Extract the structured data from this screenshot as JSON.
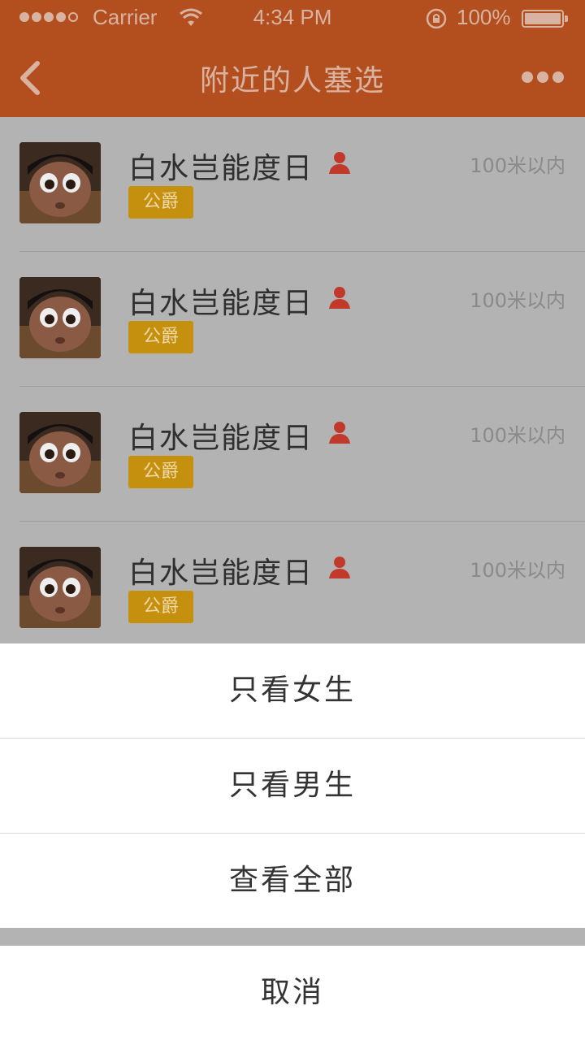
{
  "status_bar": {
    "carrier": "Carrier",
    "time": "4:34 PM",
    "battery_percent": "100%",
    "signal_bars_filled": 4,
    "signal_bars_total": 5
  },
  "nav": {
    "title": "附近的人塞选",
    "back_icon": "chevron-left-icon",
    "more_icon": "more-dots-icon"
  },
  "people": [
    {
      "name": "白水岂能度日",
      "badge": "公爵",
      "distance": "100米以内",
      "gender_icon": "female-icon"
    },
    {
      "name": "白水岂能度日",
      "badge": "公爵",
      "distance": "100米以内",
      "gender_icon": "female-icon"
    },
    {
      "name": "白水岂能度日",
      "badge": "公爵",
      "distance": "100米以内",
      "gender_icon": "female-icon"
    },
    {
      "name": "白水岂能度日",
      "badge": "公爵",
      "distance": "100米以内",
      "gender_icon": "female-icon"
    }
  ],
  "action_sheet": {
    "options": [
      "只看女生",
      "只看男生",
      "查看全部"
    ],
    "cancel": "取消"
  },
  "colors": {
    "header": "#b34f1f",
    "overlay": "#b3b3b3",
    "badge": "#c5900e",
    "gender": "#c0392b"
  }
}
